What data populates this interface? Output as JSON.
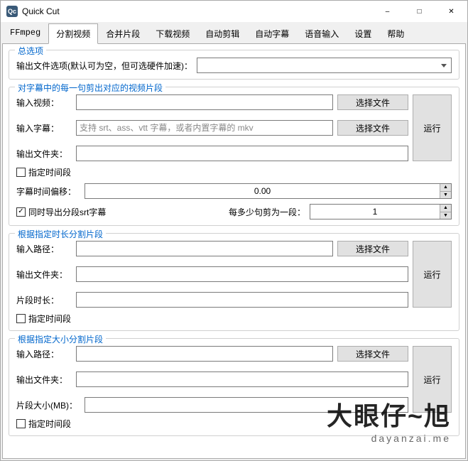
{
  "window": {
    "app_icon_text": "Qc",
    "title": "Quick Cut"
  },
  "tabs": [
    "FFmpeg",
    "分割视频",
    "合并片段",
    "下载视频",
    "自动剪辑",
    "自动字幕",
    "语音输入",
    "设置",
    "帮助"
  ],
  "active_tab_index": 1,
  "group_general": {
    "legend": "总选项",
    "output_options_label": "输出文件选项(默认可为空，但可选硬件加速)："
  },
  "group_subtitle": {
    "legend": "对字幕中的每一句剪出对应的视频片段",
    "input_video_label": "输入视频：",
    "input_subtitle_label": "输入字幕：",
    "input_subtitle_placeholder": "支持 srt、ass、vtt 字幕，或者内置字幕的 mkv",
    "output_folder_label": "输出文件夹：",
    "choose_file": "选择文件",
    "run": "运行",
    "specify_range": "指定时间段",
    "offset_label": "字幕时间偏移：",
    "offset_value": "0.00",
    "export_srt": "同时导出分段srt字幕",
    "per_lines_label": "每多少句剪为一段：",
    "per_lines_value": "1"
  },
  "group_duration": {
    "legend": "根据指定时长分割片段",
    "input_path_label": "输入路径：",
    "output_folder_label": "输出文件夹：",
    "segment_duration_label": "片段时长：",
    "choose_file": "选择文件",
    "run": "运行",
    "specify_range": "指定时间段"
  },
  "group_size": {
    "legend": "根据指定大小分割片段",
    "input_path_label": "输入路径：",
    "output_folder_label": "输出文件夹：",
    "segment_size_label": "片段大小(MB)：",
    "choose_file": "选择文件",
    "run": "运行",
    "specify_range": "指定时间段"
  },
  "watermark": {
    "main": "大眼仔~旭",
    "sub": "dayanzai.me"
  }
}
